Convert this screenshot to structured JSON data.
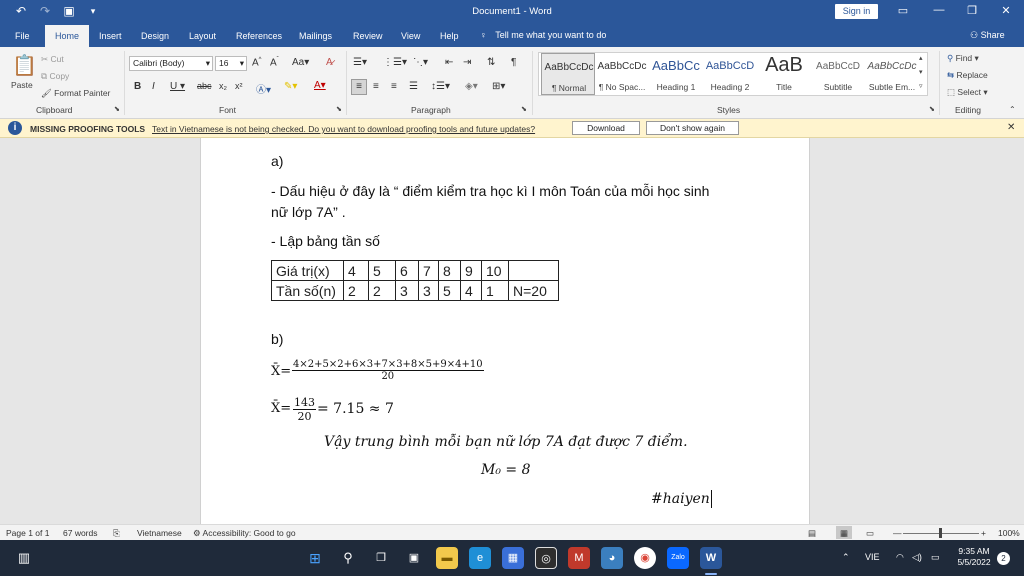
{
  "titlebar": {
    "document_title": "Document1 - Word",
    "sign_in": "Sign in"
  },
  "tabs": [
    "File",
    "Home",
    "Insert",
    "Design",
    "Layout",
    "References",
    "Mailings",
    "Review",
    "View",
    "Help"
  ],
  "tell_me": "Tell me what you want to do",
  "share": "Share",
  "ribbon": {
    "clipboard": {
      "paste": "Paste",
      "cut": "Cut",
      "copy": "Copy",
      "format_painter": "Format Painter",
      "label": "Clipboard"
    },
    "font": {
      "font_name": "Calibri (Body)",
      "font_size": "16",
      "label": "Font"
    },
    "paragraph": {
      "label": "Paragraph"
    },
    "styles": {
      "label": "Styles",
      "items": [
        {
          "preview": "AaBbCcDc",
          "name": "¶ Normal"
        },
        {
          "preview": "AaBbCcDc",
          "name": "¶ No Spac..."
        },
        {
          "preview": "AaBbCc",
          "name": "Heading 1"
        },
        {
          "preview": "AaBbCcD",
          "name": "Heading 2"
        },
        {
          "preview": "AaB",
          "name": "Title"
        },
        {
          "preview": "AaBbCcD",
          "name": "Subtitle"
        },
        {
          "preview": "AaBbCcDc",
          "name": "Subtle Em..."
        }
      ]
    },
    "editing": {
      "find": "Find",
      "replace": "Replace",
      "select": "Select",
      "label": "Editing"
    }
  },
  "message_bar": {
    "title": "MISSING PROOFING TOOLS",
    "text": "Text in Vietnamese is not being checked. Do you want to download proofing tools and future updates?",
    "download": "Download",
    "dont_show": "Don't show again"
  },
  "document": {
    "part_a": "a)",
    "line1": "- Dấu hiệu ở đây là “ điểm kiểm tra học kì I môn Toán của mỗi học sinh",
    "line2": "nữ lớp 7A” .",
    "line3": "- Lập bảng tần số",
    "table": {
      "row1": [
        "Giá trị(x)",
        "4",
        "5",
        "6",
        "7",
        "8",
        "9",
        "10",
        ""
      ],
      "row2": [
        "Tần số(n)",
        "2",
        "2",
        "3",
        "3",
        "5",
        "4",
        "1",
        "N=20"
      ]
    },
    "part_b": "b)",
    "xbar": "X̄=",
    "frac1_num": "4×2+5×2+6×3+7×3+8×5+9×4+10",
    "frac1_den": "20",
    "frac2_num": "143",
    "frac2_den": "20",
    "result": "= 7.15 ≈ 7",
    "conclusion": "Vậy trung bình mỗi bạn nữ lớp 7A đạt được 7 điểm.",
    "mode": "M₀ = 8",
    "signature": "#haiyen"
  },
  "statusbar": {
    "page": "Page 1 of 1",
    "words": "67 words",
    "language": "Vietnamese",
    "accessibility": "Accessibility: Good to go",
    "zoom": "100%"
  },
  "taskbar": {
    "lang": "VIE",
    "time": "9:35 AM",
    "date": "5/5/2022",
    "notifications": "2"
  }
}
